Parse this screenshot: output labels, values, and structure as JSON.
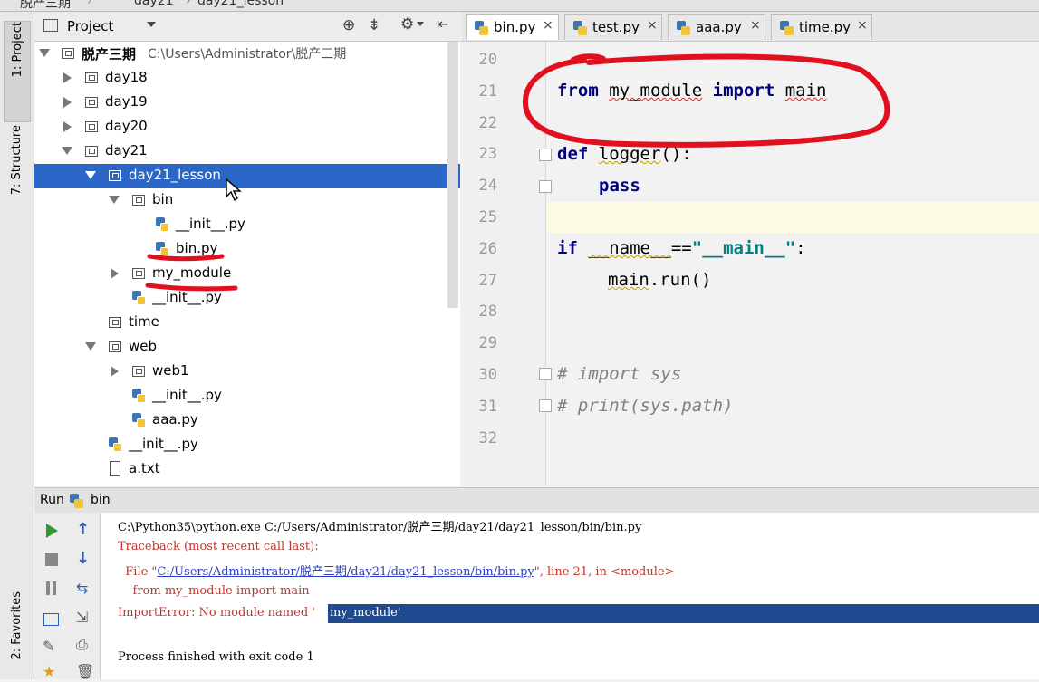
{
  "breadcrumb": [
    "脱产三期",
    "day21",
    "day21_lesson"
  ],
  "left_stripe": {
    "project_tab": "1: Project",
    "structure_tab": "7: Structure",
    "favorites_tab": "2: Favorites"
  },
  "project_panel": {
    "title": "Project"
  },
  "tree": {
    "root": {
      "label": "脱产三期",
      "path": "C:\\Users\\Administrator\\脱产三期"
    },
    "items": [
      {
        "label": "day18"
      },
      {
        "label": "day19"
      },
      {
        "label": "day20"
      },
      {
        "label": "day21"
      },
      {
        "label": "day21_lesson"
      },
      {
        "label": "bin"
      },
      {
        "label": "__init__.py"
      },
      {
        "label": "bin.py"
      },
      {
        "label": "my_module"
      },
      {
        "label": "__init__.py"
      },
      {
        "label": "time"
      },
      {
        "label": "web"
      },
      {
        "label": "web1"
      },
      {
        "label": "__init__.py"
      },
      {
        "label": "aaa.py"
      },
      {
        "label": "__init__.py"
      },
      {
        "label": "a.txt"
      }
    ]
  },
  "tabs": [
    {
      "label": "bin.py",
      "active": true
    },
    {
      "label": "test.py"
    },
    {
      "label": "aaa.py"
    },
    {
      "label": "time.py"
    }
  ],
  "editor": {
    "line_numbers": [
      "20",
      "21",
      "22",
      "23",
      "24",
      "25",
      "26",
      "27",
      "28",
      "29",
      "30",
      "31",
      "32"
    ],
    "current_line": "25",
    "code": {
      "l21_kw1": "from",
      "l21_mod": "my_module",
      "l21_kw2": "import",
      "l21_name": "main",
      "l23_kw": "def",
      "l23_name": "logger",
      "l23_rest": "():",
      "l24_kw": "pass",
      "l26_kw": "if",
      "l26_name": "__name__",
      "l26_op": "==",
      "l26_str": "\"__main__\"",
      "l26_end": ":",
      "l27_obj": "main",
      "l27_rest": ".run()",
      "l30_cmt": "# import sys",
      "l31_cmt": "# print(sys.path)"
    }
  },
  "run_panel": {
    "title": "Run",
    "config": "bin",
    "console": {
      "cmd": "C:\\Python35\\python.exe C:/Users/Administrator/脱产三期/day21/day21_lesson/bin/bin.py",
      "traceback": "Traceback (most recent call last):",
      "file_prefix": "  File \"",
      "file_link": "C:/Users/Administrator/脱产三期/day21/day21_lesson/bin/bin.py",
      "file_suffix": "\", line 21, in <module>",
      "src_line": "    from my_module import main",
      "error_prefix": "ImportError: No module named '",
      "error_highlight": "my_module'",
      "finished": "Process finished with exit code 1"
    }
  },
  "colors": {
    "selection": "#2a67c8",
    "keyword": "#000080",
    "string": "#008080",
    "error": "#c2352d",
    "annotation_ink": "#e0101e"
  }
}
